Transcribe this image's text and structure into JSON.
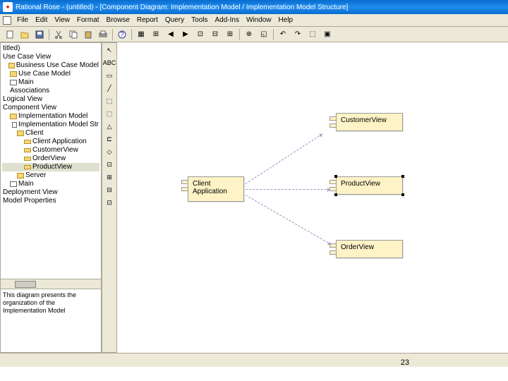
{
  "window": {
    "title": "Rational Rose - (untitled) - [Component Diagram: Implementation Model / Implementation Model Structure]"
  },
  "menu": {
    "items": [
      "File",
      "Edit",
      "View",
      "Format",
      "Browse",
      "Report",
      "Query",
      "Tools",
      "Add-Ins",
      "Window",
      "Help"
    ]
  },
  "tree": {
    "items": [
      {
        "label": "titled)",
        "indent": 0,
        "kind": "text"
      },
      {
        "label": "Use Case View",
        "indent": 0,
        "kind": "text"
      },
      {
        "label": "Business Use Case Model",
        "indent": 1,
        "kind": "folder"
      },
      {
        "label": "Use Case Model",
        "indent": 1,
        "kind": "folder"
      },
      {
        "label": "Main",
        "indent": 1,
        "kind": "pkg"
      },
      {
        "label": "Associations",
        "indent": 1,
        "kind": "text"
      },
      {
        "label": "Logical View",
        "indent": 0,
        "kind": "text"
      },
      {
        "label": "Component View",
        "indent": 0,
        "kind": "text"
      },
      {
        "label": "Implementation Model",
        "indent": 1,
        "kind": "folder"
      },
      {
        "label": "Implementation Model Str",
        "indent": 2,
        "kind": "pkg"
      },
      {
        "label": "Client",
        "indent": 2,
        "kind": "folder"
      },
      {
        "label": "Client Application",
        "indent": 3,
        "kind": "comp"
      },
      {
        "label": "CustomerView",
        "indent": 3,
        "kind": "comp"
      },
      {
        "label": "OrderView",
        "indent": 3,
        "kind": "comp"
      },
      {
        "label": "ProductView",
        "indent": 3,
        "kind": "comp",
        "sel": true
      },
      {
        "label": "Server",
        "indent": 2,
        "kind": "folder"
      },
      {
        "label": "Main",
        "indent": 1,
        "kind": "pkg"
      },
      {
        "label": "Deployment View",
        "indent": 0,
        "kind": "text"
      },
      {
        "label": "Model Properties",
        "indent": 0,
        "kind": "text"
      }
    ]
  },
  "doc": {
    "text": "This diagram presents the organization of the Implementation Model"
  },
  "toolbox": {
    "labels": [
      "↖",
      "ABC",
      "▭",
      "╱",
      "⬚",
      "⬚",
      "△",
      "⊏",
      "◇",
      "⊡",
      "⊞",
      "⊟",
      "⊡"
    ]
  },
  "diagram": {
    "client": "Client\nApplication",
    "customer": "CustomerView",
    "product": "ProductView",
    "order": "OrderView"
  },
  "page": "23"
}
